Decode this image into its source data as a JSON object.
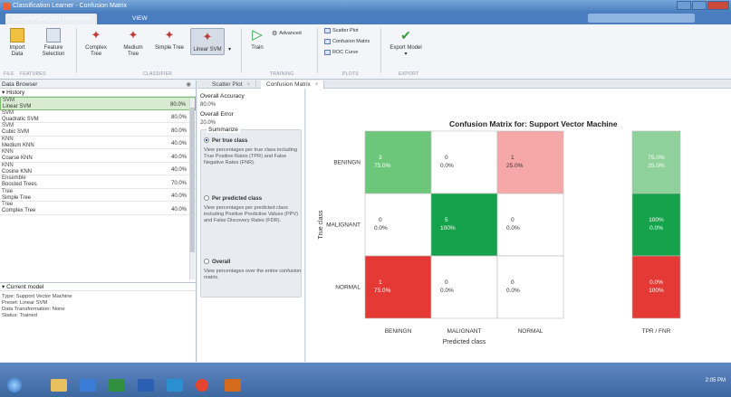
{
  "window": {
    "title": "Classification Learner - Confusion Matrix"
  },
  "tabs": [
    "CLASSIFICATION LEARNER",
    "VIEW"
  ],
  "ribbon": {
    "import": "Import\nData",
    "feature": "Feature\nSelection",
    "classifiers": [
      "Complex\nTree",
      "Medium Tree",
      "Simple Tree",
      "Linear SVM"
    ],
    "advanced": "Advanced",
    "train": "Train",
    "plots": [
      "Scatter Plot",
      "Confusion Matrix",
      "ROC Curve"
    ],
    "export": "Export Model",
    "groups": [
      "FILE",
      "FEATURES",
      "CLASSIFIER",
      "TRAINING",
      "PLOTS",
      "EXPORT"
    ]
  },
  "doc_tabs": [
    "Scatter Plot",
    "Confusion Matrix"
  ],
  "data_browser": {
    "title": "Data Browser",
    "history_label": "History",
    "items": [
      {
        "name": "SVM",
        "sub": "Linear SVM",
        "acc": "80.0%",
        "selected": true
      },
      {
        "name": "SVM",
        "sub": "Quadratic SVM",
        "acc": "80.0%"
      },
      {
        "name": "SVM",
        "sub": "Cubic SVM",
        "acc": "80.0%"
      },
      {
        "name": "KNN",
        "sub": "Medium KNN",
        "acc": "40.0%"
      },
      {
        "name": "KNN",
        "sub": "Coarse KNN",
        "acc": "40.0%"
      },
      {
        "name": "KNN",
        "sub": "Cosine KNN",
        "acc": "40.0%"
      },
      {
        "name": "Ensemble",
        "sub": "Boosted Trees",
        "acc": "70.0%"
      },
      {
        "name": "Tree",
        "sub": "Simple Tree",
        "acc": "40.0%"
      },
      {
        "name": "Tree",
        "sub": "Complex Tree",
        "acc": "40.0%"
      }
    ],
    "current_model_label": "Current model",
    "current_model": [
      "Type: Support Vector Machine",
      "Preset: Linear SVM",
      "Data Transformation: None",
      "Status: Trained"
    ]
  },
  "summary": {
    "overall_accuracy_label": "Overall Accuracy",
    "overall_accuracy": "80.0%",
    "overall_error_label": "Overall Error",
    "overall_error": "20.0%",
    "summarize_label": "Summarize",
    "options": [
      {
        "title": "Per true class",
        "desc": "View percentages per true class including True Positive Rates (TPR) and False Negative Rates (FNR).",
        "selected": true
      },
      {
        "title": "Per predicted class",
        "desc": "View percentages per predicted class including Positive Predictive Values (PPV) and False Discovery Rates (FDR)."
      },
      {
        "title": "Overall",
        "desc": "View percentages over the entire confusion matrix."
      }
    ]
  },
  "chart_data": {
    "type": "heatmap",
    "title": "Confusion Matrix for: Support Vector Machine",
    "xlabel": "Predicted class",
    "ylabel": "True class",
    "rows": [
      "BENINGN",
      "MALIGNANT",
      "NORMAL"
    ],
    "cols": [
      "BENINGN",
      "MALIGNANT",
      "NORMAL"
    ],
    "counts": [
      [
        3,
        0,
        1
      ],
      [
        0,
        5,
        0
      ],
      [
        1,
        0,
        0
      ]
    ],
    "percents": [
      [
        "75.0%",
        "0.0%",
        "25.0%"
      ],
      [
        "0.0%",
        "100%",
        "0.0%"
      ],
      [
        "75.0%",
        "0.0%",
        "0.0%"
      ]
    ],
    "cell_colors": [
      [
        "#6cc77a",
        "#ffffff",
        "#f6a7a7"
      ],
      [
        "#ffffff",
        "#14a34a",
        "#ffffff"
      ],
      [
        "#e53935",
        "#ffffff",
        "#ffffff"
      ]
    ],
    "tpr_fnr_label": "TPR / FNR",
    "tpr_fnr": [
      [
        "75.0%",
        "25.0%"
      ],
      [
        "100%",
        "0.0%"
      ],
      [
        "0.0%",
        "100%"
      ]
    ],
    "tpr_fnr_colors": [
      "#8fd19a",
      "#14a34a",
      "#e53935"
    ]
  },
  "taskbar": {
    "time": "2:05 PM"
  }
}
